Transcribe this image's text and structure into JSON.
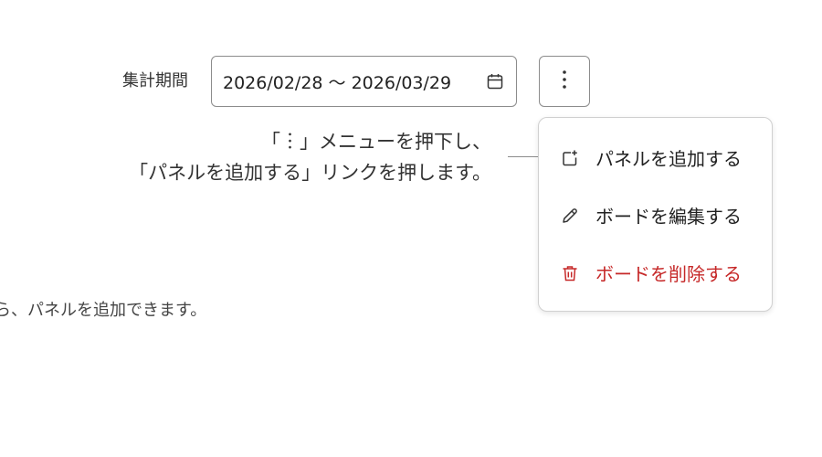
{
  "filter": {
    "period_label": "集計期間",
    "date_range": "2026/02/28 〜 2026/03/29"
  },
  "more_button": {
    "icon": "more-vertical-icon"
  },
  "callout": {
    "line1": "「︙」メニューを押下し、",
    "line2": "「パネルを追加する」リンクを押します。"
  },
  "menu": {
    "items": [
      {
        "label": "パネルを追加する",
        "icon": "add-panel-icon"
      },
      {
        "label": "ボードを編集する",
        "icon": "pencil-icon"
      },
      {
        "label": "ボードを削除する",
        "icon": "trash-icon",
        "color": "#c62828"
      }
    ]
  },
  "background_text": "ら、パネルを追加できます。"
}
